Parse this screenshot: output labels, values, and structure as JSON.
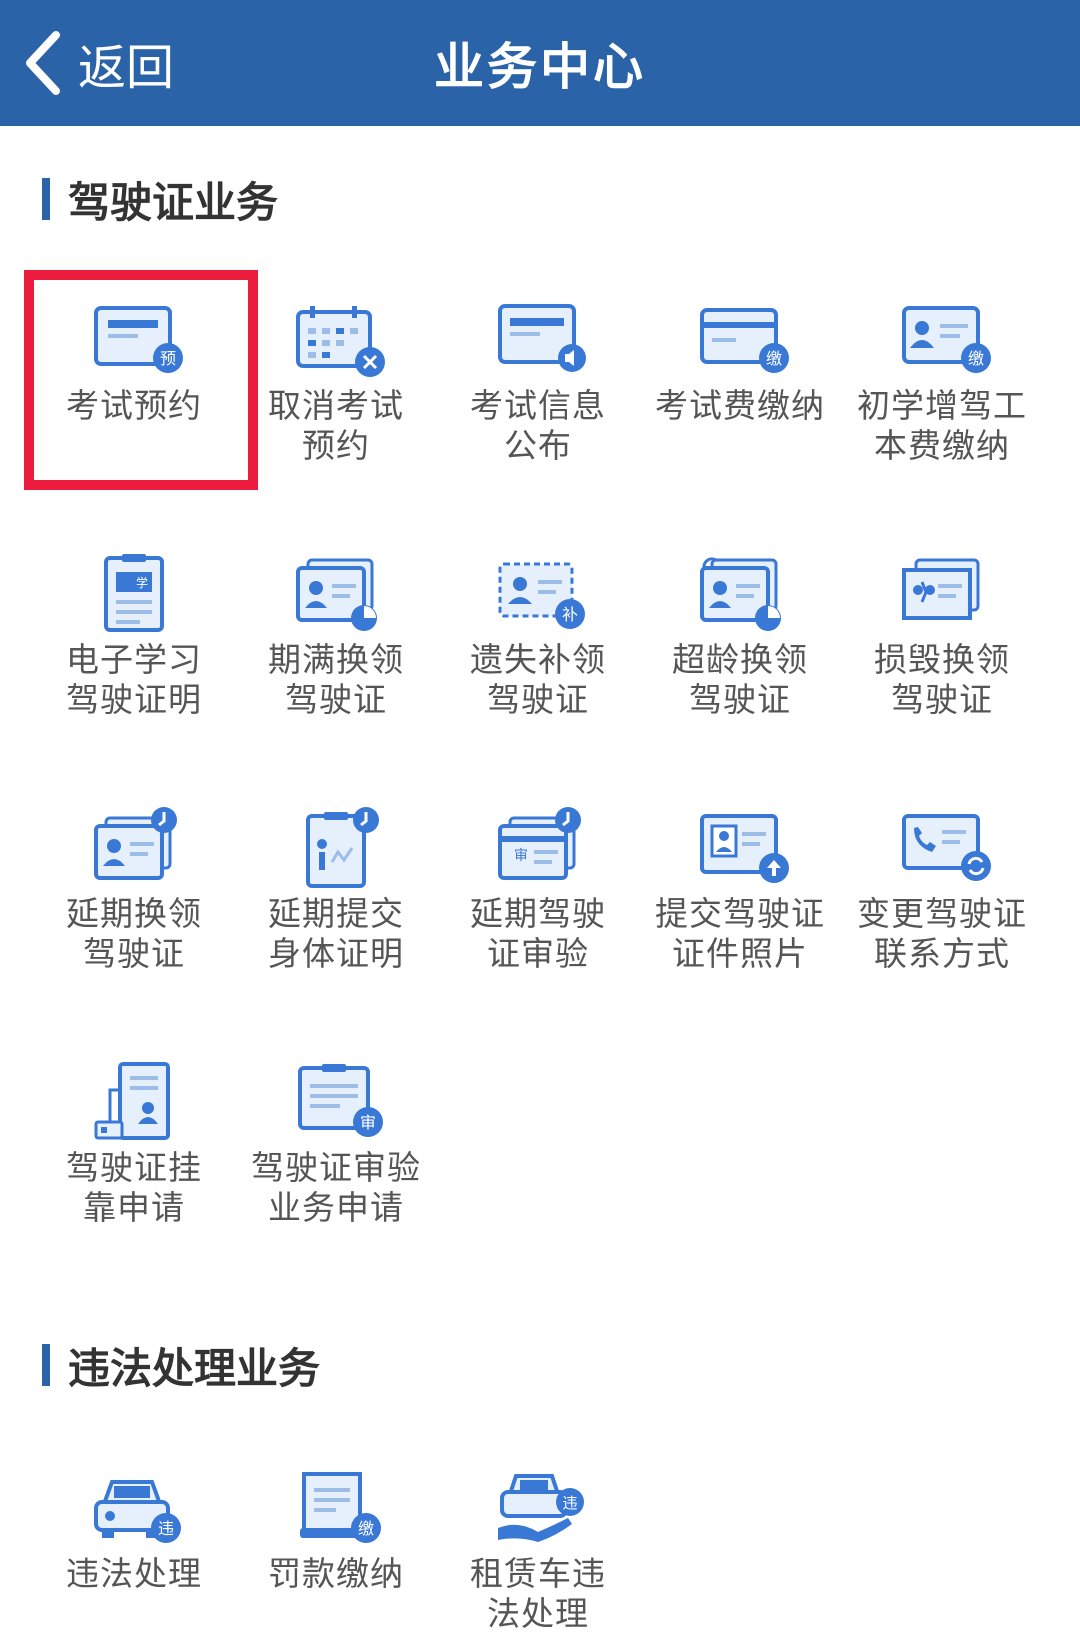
{
  "header": {
    "back_label": "返回",
    "title": "业务中心"
  },
  "sections": [
    {
      "title": "驾驶证业务",
      "items": [
        {
          "line1": "考试预约",
          "line2": "",
          "icon": "calendar-card-icon"
        },
        {
          "line1": "取消考试",
          "line2": "预约",
          "icon": "calendar-cancel-icon"
        },
        {
          "line1": "考试信息",
          "line2": "公布",
          "icon": "card-speaker-icon"
        },
        {
          "line1": "考试费缴纳",
          "line2": "",
          "icon": "card-pay-icon"
        },
        {
          "line1": "初学增驾工",
          "line2": "本费缴纳",
          "icon": "id-card-pay-icon"
        },
        {
          "line1": "电子学习",
          "line2": "驾驶证明",
          "icon": "clipboard-learn-icon"
        },
        {
          "line1": "期满换领",
          "line2": "驾驶证",
          "icon": "license-renew-icon"
        },
        {
          "line1": "遗失补领",
          "line2": "驾驶证",
          "icon": "license-reissue-icon"
        },
        {
          "line1": "超龄换领",
          "line2": "驾驶证",
          "icon": "license-overage-icon"
        },
        {
          "line1": "损毁换领",
          "line2": "驾驶证",
          "icon": "license-damaged-icon"
        },
        {
          "line1": "延期换领",
          "line2": "驾驶证",
          "icon": "license-delay-icon"
        },
        {
          "line1": "延期提交",
          "line2": "身体证明",
          "icon": "health-cert-delay-icon"
        },
        {
          "line1": "延期驾驶",
          "line2": "证审验",
          "icon": "audit-delay-icon"
        },
        {
          "line1": "提交驾驶证",
          "line2": "证件照片",
          "icon": "photo-upload-icon"
        },
        {
          "line1": "变更驾驶证",
          "line2": "联系方式",
          "icon": "contact-change-icon"
        },
        {
          "line1": "驾驶证挂",
          "line2": "靠申请",
          "icon": "affiliation-doc-icon"
        },
        {
          "line1": "驾驶证审验",
          "line2": "业务申请",
          "icon": "audit-apply-icon"
        }
      ]
    },
    {
      "title": "违法处理业务",
      "items": [
        {
          "line1": "违法处理",
          "line2": "",
          "icon": "car-violation-icon"
        },
        {
          "line1": "罚款缴纳",
          "line2": "",
          "icon": "fine-pay-icon"
        },
        {
          "line1": "租赁车违",
          "line2": "法处理",
          "icon": "rental-car-violation-icon"
        }
      ]
    }
  ],
  "badges": {
    "yu": "预",
    "jiao": "缴",
    "bu": "补",
    "shen": "审",
    "wei": "违",
    "xue": "学"
  },
  "colors": {
    "brand": "#2b63a9",
    "icon_fill": "#3a78d6",
    "highlight": "#ec1c3f"
  }
}
